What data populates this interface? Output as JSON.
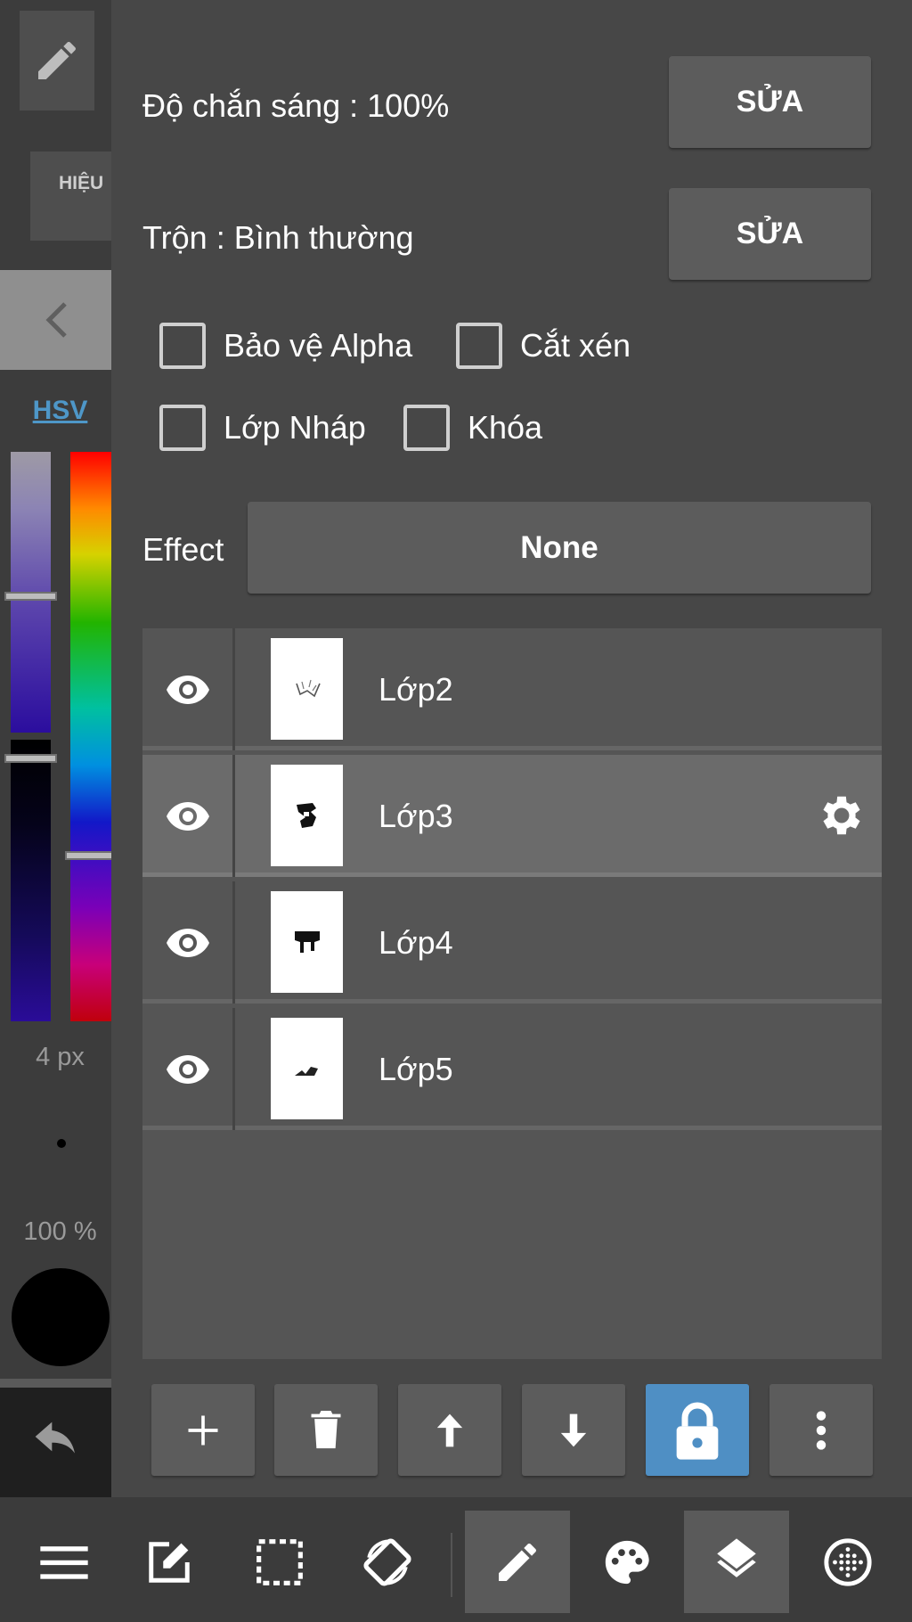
{
  "left_panel": {
    "effect_tab_label": "HIỆU",
    "color_mode_label": "HSV",
    "brush_size": "4 px",
    "brush_opacity": "100 %",
    "current_color": "#000000"
  },
  "layer_props": {
    "opacity_label": "Độ chắn sáng : 100%",
    "blend_label": "Trộn : Bình thường",
    "edit_button_label": "SỬA",
    "checkboxes": [
      {
        "label": "Bảo vệ Alpha",
        "checked": false
      },
      {
        "label": "Cắt xén",
        "checked": false
      },
      {
        "label": "Lớp Nháp",
        "checked": false
      },
      {
        "label": "Khóa",
        "checked": false
      }
    ],
    "effect_label": "Effect",
    "effect_value": "None"
  },
  "layers": [
    {
      "name": "Lớp2",
      "visible": true,
      "selected": false
    },
    {
      "name": "Lớp3",
      "visible": true,
      "selected": true
    },
    {
      "name": "Lớp4",
      "visible": true,
      "selected": false
    },
    {
      "name": "Lớp5",
      "visible": true,
      "selected": false
    }
  ],
  "layer_toolbar": [
    {
      "icon": "plus-icon",
      "active": false
    },
    {
      "icon": "trash-icon",
      "active": false
    },
    {
      "icon": "arrow-up-icon",
      "active": false
    },
    {
      "icon": "arrow-down-icon",
      "active": false
    },
    {
      "icon": "lock-icon",
      "active": true
    },
    {
      "icon": "more-vertical-icon",
      "active": false
    }
  ],
  "bottom_toolbar": [
    {
      "icon": "menu-icon",
      "active": false
    },
    {
      "icon": "edit-icon",
      "active": false
    },
    {
      "icon": "selection-icon",
      "active": false
    },
    {
      "icon": "rotate-icon",
      "active": false
    },
    {
      "icon": "pencil-icon",
      "active": true
    },
    {
      "icon": "palette-icon",
      "active": false
    },
    {
      "icon": "layers-icon",
      "active": true
    },
    {
      "icon": "material-icon",
      "active": false
    }
  ],
  "colors": {
    "accent": "#4f8fc4",
    "hsv_link": "#4e97c8",
    "panel_bg": "#474747",
    "button_bg": "#5c5c5c"
  }
}
